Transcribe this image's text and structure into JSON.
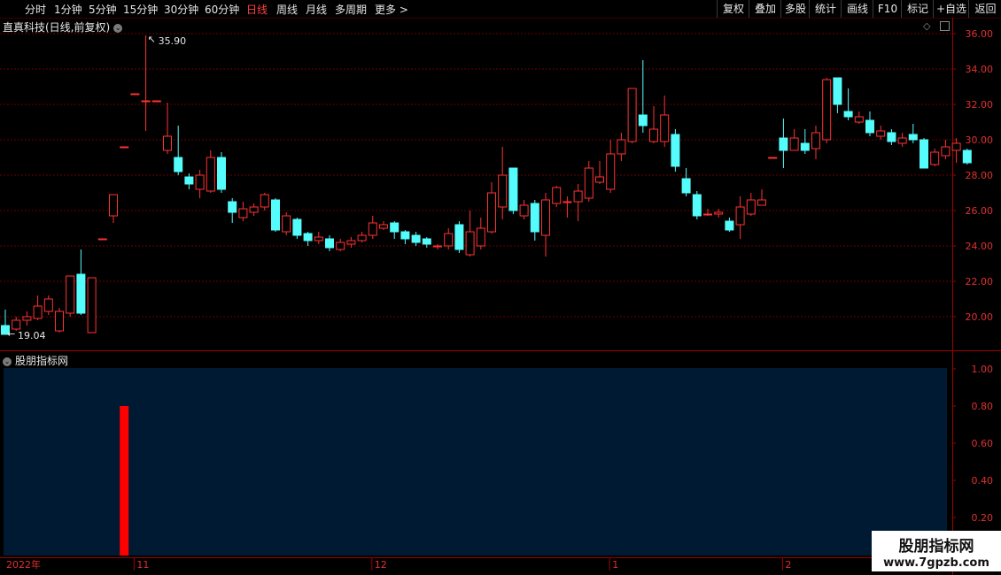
{
  "toolbar": {
    "periods": [
      "分时",
      "1分钟",
      "5分钟",
      "15分钟",
      "30分钟",
      "60分钟",
      "日线",
      "周线",
      "月线",
      "多周期",
      "更多 >"
    ],
    "active_period": "日线",
    "right_buttons": [
      "复权",
      "叠加",
      "多股",
      "统计",
      "画线",
      "F10",
      "标记",
      "+自选",
      "返回"
    ]
  },
  "main_title": "直真科技(日线,前复权)",
  "indicator_title": "股朋指标网",
  "watermark": {
    "line1": "股朋指标网",
    "line2": "www.7gpzb.com"
  },
  "colors": {
    "up": "#ff3232",
    "down": "#54fcfc",
    "bg": "#000000",
    "indicator_bg": "#001a33",
    "indicator_bar": "#ff0000"
  },
  "chart_data": [
    {
      "type": "candlestick",
      "title": "直真科技(日线,前复权)",
      "ylim": [
        18.0,
        36.5
      ],
      "yticks": [
        20,
        22,
        24,
        26,
        28,
        30,
        32,
        34,
        36
      ],
      "ytick_labels": [
        "20.00",
        "22.00",
        "24.00",
        "26.00",
        "28.00",
        "30.00",
        "32.00",
        "34.00",
        "36.00"
      ],
      "x_labels": [
        {
          "index": 0,
          "text": "2022年"
        },
        {
          "index": 12,
          "text": "11"
        },
        {
          "index": 34,
          "text": "12"
        },
        {
          "index": 56,
          "text": "1"
        },
        {
          "index": 72,
          "text": "2"
        }
      ],
      "annotations": [
        {
          "text": "35.90",
          "index": 13,
          "value": 35.9,
          "kind": "high"
        },
        {
          "text": "19.04",
          "index": 0,
          "value": 19.04,
          "kind": "low"
        }
      ],
      "candles": [
        [
          19.5,
          19.0,
          20.4,
          19.04
        ],
        [
          19.3,
          19.8,
          20.0,
          19.2
        ],
        [
          19.8,
          20.0,
          20.3,
          19.5
        ],
        [
          19.9,
          20.6,
          21.2,
          19.8
        ],
        [
          20.3,
          21.0,
          21.2,
          20.1
        ],
        [
          19.2,
          20.3,
          20.5,
          19.1
        ],
        [
          20.2,
          22.3,
          22.3,
          20.0
        ],
        [
          22.4,
          20.2,
          23.8,
          20.1
        ],
        [
          19.1,
          22.2,
          22.2,
          19.1
        ],
        [
          24.4,
          24.4,
          24.4,
          24.4
        ],
        [
          25.7,
          26.9,
          26.9,
          25.3
        ],
        [
          29.6,
          29.6,
          29.6,
          29.6
        ],
        [
          32.6,
          32.6,
          32.6,
          32.6
        ],
        [
          32.2,
          32.2,
          35.9,
          30.5
        ],
        [
          32.2,
          32.2,
          32.2,
          32.2
        ],
        [
          29.4,
          30.2,
          32.1,
          29.2
        ],
        [
          29.0,
          28.2,
          30.8,
          28.0
        ],
        [
          27.9,
          27.5,
          28.1,
          27.2
        ],
        [
          27.2,
          28.0,
          28.3,
          26.7
        ],
        [
          27.1,
          29.0,
          29.4,
          27.0
        ],
        [
          29.0,
          27.2,
          29.3,
          27.0
        ],
        [
          26.5,
          25.9,
          26.7,
          25.3
        ],
        [
          25.6,
          26.1,
          26.5,
          25.4
        ],
        [
          25.9,
          26.2,
          26.4,
          25.7
        ],
        [
          26.2,
          26.9,
          27.0,
          26.0
        ],
        [
          26.6,
          24.9,
          26.7,
          24.8
        ],
        [
          24.8,
          25.7,
          25.9,
          24.6
        ],
        [
          25.5,
          24.6,
          25.6,
          24.4
        ],
        [
          24.7,
          24.3,
          24.8,
          24.0
        ],
        [
          24.3,
          24.5,
          24.8,
          24.1
        ],
        [
          24.4,
          23.9,
          24.6,
          23.7
        ],
        [
          23.8,
          24.2,
          24.4,
          23.7
        ],
        [
          24.1,
          24.3,
          24.5,
          23.9
        ],
        [
          24.3,
          24.6,
          24.8,
          24.2
        ],
        [
          24.6,
          25.3,
          25.7,
          24.4
        ],
        [
          25.0,
          25.2,
          25.4,
          24.9
        ],
        [
          25.3,
          24.8,
          25.4,
          24.4
        ],
        [
          24.8,
          24.4,
          24.9,
          24.1
        ],
        [
          24.6,
          24.2,
          24.8,
          24.0
        ],
        [
          24.4,
          24.1,
          24.5,
          23.9
        ],
        [
          24.0,
          24.0,
          24.1,
          23.8
        ],
        [
          24.0,
          24.7,
          25.0,
          23.8
        ],
        [
          25.2,
          23.8,
          25.4,
          23.6
        ],
        [
          23.5,
          24.8,
          26.0,
          23.4
        ],
        [
          24.0,
          25.0,
          25.6,
          23.8
        ],
        [
          24.8,
          27.0,
          27.6,
          24.7
        ],
        [
          26.2,
          28.0,
          29.6,
          25.5
        ],
        [
          28.4,
          26.0,
          28.4,
          25.8
        ],
        [
          25.7,
          26.3,
          26.6,
          25.5
        ],
        [
          26.4,
          24.8,
          26.6,
          24.3
        ],
        [
          24.6,
          26.6,
          27.0,
          23.4
        ],
        [
          26.4,
          27.3,
          27.4,
          26.2
        ],
        [
          26.5,
          26.5,
          26.8,
          25.6
        ],
        [
          26.5,
          27.1,
          27.5,
          25.4
        ],
        [
          26.7,
          28.4,
          28.8,
          26.5
        ],
        [
          27.6,
          27.9,
          28.8,
          27.5
        ],
        [
          27.2,
          29.2,
          30.0,
          27.0
        ],
        [
          29.2,
          30.0,
          30.4,
          28.8
        ],
        [
          29.9,
          32.9,
          32.9,
          29.8
        ],
        [
          31.4,
          30.8,
          34.5,
          30.4
        ],
        [
          29.9,
          30.6,
          31.9,
          29.8
        ],
        [
          29.9,
          31.4,
          32.5,
          29.6
        ],
        [
          30.3,
          28.5,
          30.6,
          28.2
        ],
        [
          27.8,
          27.0,
          28.4,
          26.8
        ],
        [
          26.9,
          25.7,
          27.1,
          25.5
        ],
        [
          25.8,
          25.8,
          26.1,
          25.7
        ],
        [
          25.8,
          25.9,
          26.1,
          25.6
        ],
        [
          25.4,
          24.9,
          25.6,
          24.8
        ],
        [
          25.2,
          26.2,
          26.8,
          24.4
        ],
        [
          25.8,
          26.6,
          27.0,
          25.7
        ],
        [
          26.3,
          26.6,
          27.2,
          26.3
        ],
        [
          29.0,
          29.0,
          29.0,
          29.0
        ],
        [
          30.1,
          29.4,
          31.2,
          28.4
        ],
        [
          29.4,
          30.1,
          30.6,
          29.5
        ],
        [
          29.8,
          29.4,
          30.6,
          29.2
        ],
        [
          29.5,
          30.4,
          30.8,
          28.9
        ],
        [
          30.0,
          33.4,
          33.5,
          29.8
        ],
        [
          33.5,
          32.0,
          33.5,
          31.5
        ],
        [
          31.6,
          31.3,
          32.9,
          31.1
        ],
        [
          31.0,
          31.3,
          31.6,
          30.9
        ],
        [
          31.1,
          30.4,
          31.6,
          30.2
        ],
        [
          30.2,
          30.5,
          30.8,
          30.0
        ],
        [
          30.4,
          29.9,
          30.6,
          29.7
        ],
        [
          29.8,
          30.1,
          30.4,
          29.6
        ],
        [
          30.3,
          30.0,
          30.9,
          29.8
        ],
        [
          30.0,
          28.4,
          30.1,
          28.4
        ],
        [
          28.6,
          29.3,
          29.5,
          28.5
        ],
        [
          29.1,
          29.6,
          30.0,
          28.9
        ],
        [
          29.4,
          29.8,
          30.1,
          28.7
        ],
        [
          29.4,
          28.7,
          29.5,
          28.6
        ]
      ]
    },
    {
      "type": "bar",
      "title": "股朋指标网",
      "ylim": [
        0.0,
        1.05
      ],
      "yticks": [
        0.2,
        0.4,
        0.6,
        0.8,
        1.0
      ],
      "ytick_labels": [
        "0.20",
        "0.40",
        "0.60",
        "0.80",
        "1.00"
      ],
      "bars": [
        {
          "index": 11,
          "value": 0.8
        }
      ]
    }
  ]
}
